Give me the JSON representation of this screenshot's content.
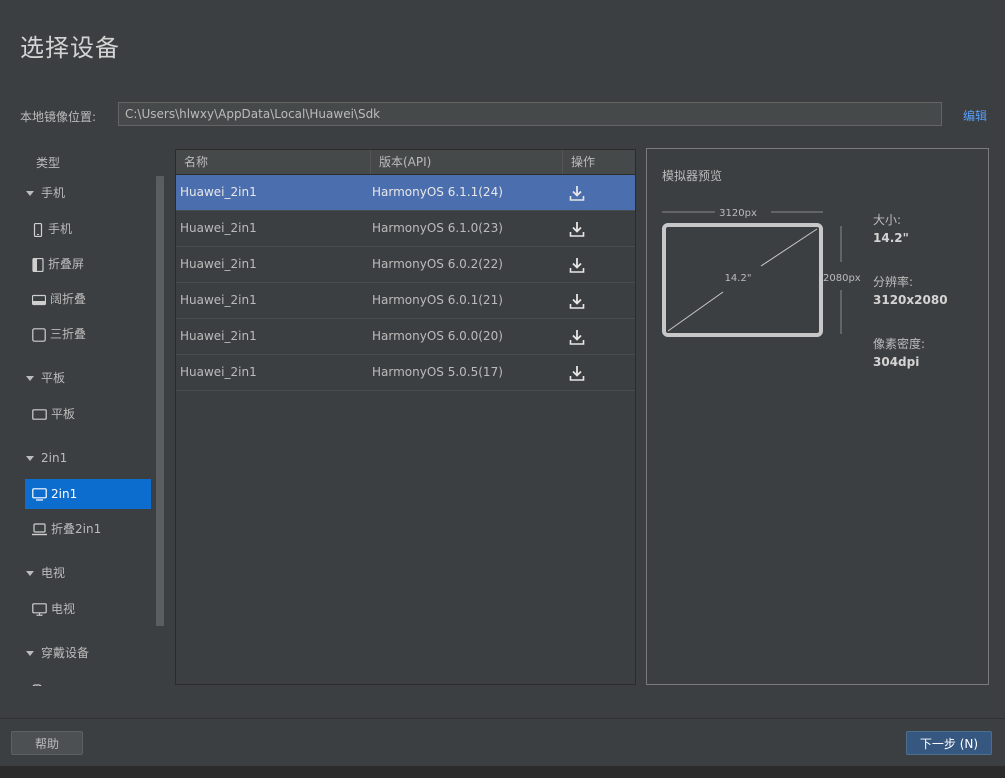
{
  "title": "选择设备",
  "local_path": {
    "label": "本地镜像位置:",
    "value": "C:\\Users\\hlwxy\\AppData\\Local\\Huawei\\Sdk",
    "edit": "编辑"
  },
  "sidebar": {
    "header": "类型",
    "categories": [
      {
        "label": "手机",
        "items": [
          {
            "label": "手机",
            "icon": "phone-icon"
          },
          {
            "label": "折叠屏",
            "icon": "foldable-icon"
          },
          {
            "label": "阔折叠",
            "icon": "wide-fold-icon"
          },
          {
            "label": "三折叠",
            "icon": "tri-fold-icon"
          }
        ]
      },
      {
        "label": "平板",
        "items": [
          {
            "label": "平板",
            "icon": "tablet-icon"
          }
        ]
      },
      {
        "label": "2in1",
        "items": [
          {
            "label": "2in1",
            "icon": "monitor-icon",
            "selected": true
          },
          {
            "label": "折叠2in1",
            "icon": "laptop-icon"
          }
        ]
      },
      {
        "label": "电视",
        "items": [
          {
            "label": "电视",
            "icon": "tv-icon"
          }
        ]
      },
      {
        "label": "穿戴设备",
        "items": []
      }
    ]
  },
  "table": {
    "headers": [
      "名称",
      "版本(API)",
      "操作"
    ],
    "rows": [
      {
        "name": "Huawei_2in1",
        "version": "HarmonyOS 6.1.1(24)",
        "selected": true
      },
      {
        "name": "Huawei_2in1",
        "version": "HarmonyOS 6.1.0(23)"
      },
      {
        "name": "Huawei_2in1",
        "version": "HarmonyOS 6.0.2(22)"
      },
      {
        "name": "Huawei_2in1",
        "version": "HarmonyOS 6.0.1(21)"
      },
      {
        "name": "Huawei_2in1",
        "version": "HarmonyOS 6.0.0(20)"
      },
      {
        "name": "Huawei_2in1",
        "version": "HarmonyOS 5.0.5(17)"
      }
    ]
  },
  "preview": {
    "title": "模拟器预览",
    "width_label": "3120px",
    "height_label": "2080px",
    "diagonal_label": "14.2\"",
    "specs": [
      {
        "label": "大小:",
        "value": "14.2\""
      },
      {
        "label": "分辨率:",
        "value": "3120x2080"
      },
      {
        "label": "像素密度:",
        "value": "304dpi"
      }
    ]
  },
  "footer": {
    "help": "帮助",
    "next": "下一步 (N)"
  },
  "colors": {
    "accent": "#0d6dcf",
    "row_selected": "#4b6eaf",
    "link": "#589df6",
    "next_button": "#365880"
  }
}
